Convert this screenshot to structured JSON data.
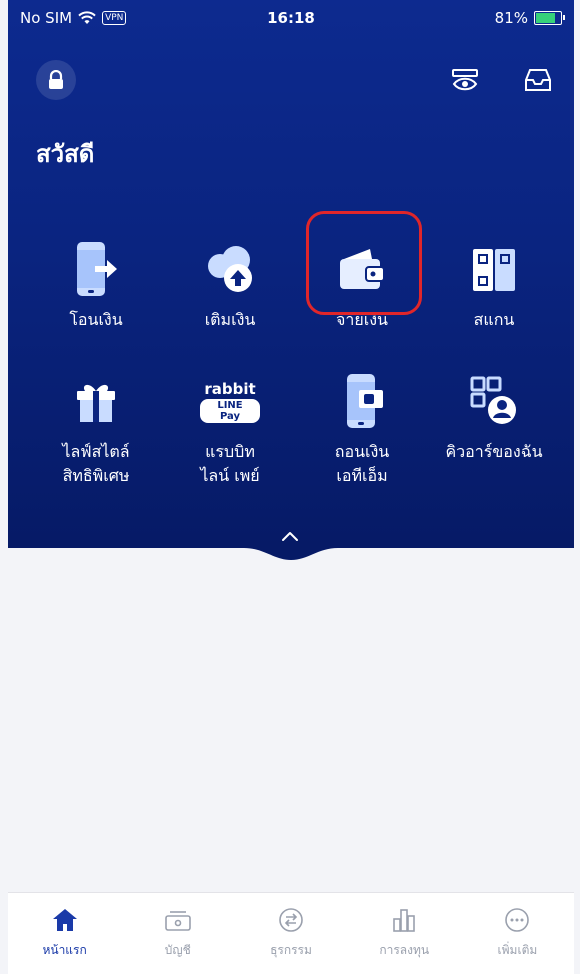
{
  "status_bar": {
    "carrier": "No SIM",
    "vpn": "VPN",
    "time": "16:18",
    "battery": "81%"
  },
  "header": {
    "greeting": "สวัสดี"
  },
  "menu": [
    {
      "label": "โอนเงิน"
    },
    {
      "label": "เติมเงิน"
    },
    {
      "label": "จ่ายเงิน"
    },
    {
      "label": "สแกน"
    },
    {
      "label": "ไลฟ์สไตล์\nสิทธิพิเศษ"
    },
    {
      "label": "แรบบิท\nไลน์ เพย์"
    },
    {
      "label": "ถอนเงิน\nเอทีเอ็ม"
    },
    {
      "label": "คิวอาร์ของฉัน"
    }
  ],
  "rabbit_logo": {
    "top": "rabbit",
    "bottom": "LINE Pay"
  },
  "bottom_nav": [
    {
      "label": "หน้าแรก",
      "active": true
    },
    {
      "label": "บัญชี",
      "active": false
    },
    {
      "label": "ธุรกรรม",
      "active": false
    },
    {
      "label": "การลงทุน",
      "active": false
    },
    {
      "label": "เพิ่มเติม",
      "active": false
    }
  ],
  "colors": {
    "primary": "#0a2480",
    "highlight": "#e0262a",
    "icon_light": "#c9dcff"
  }
}
